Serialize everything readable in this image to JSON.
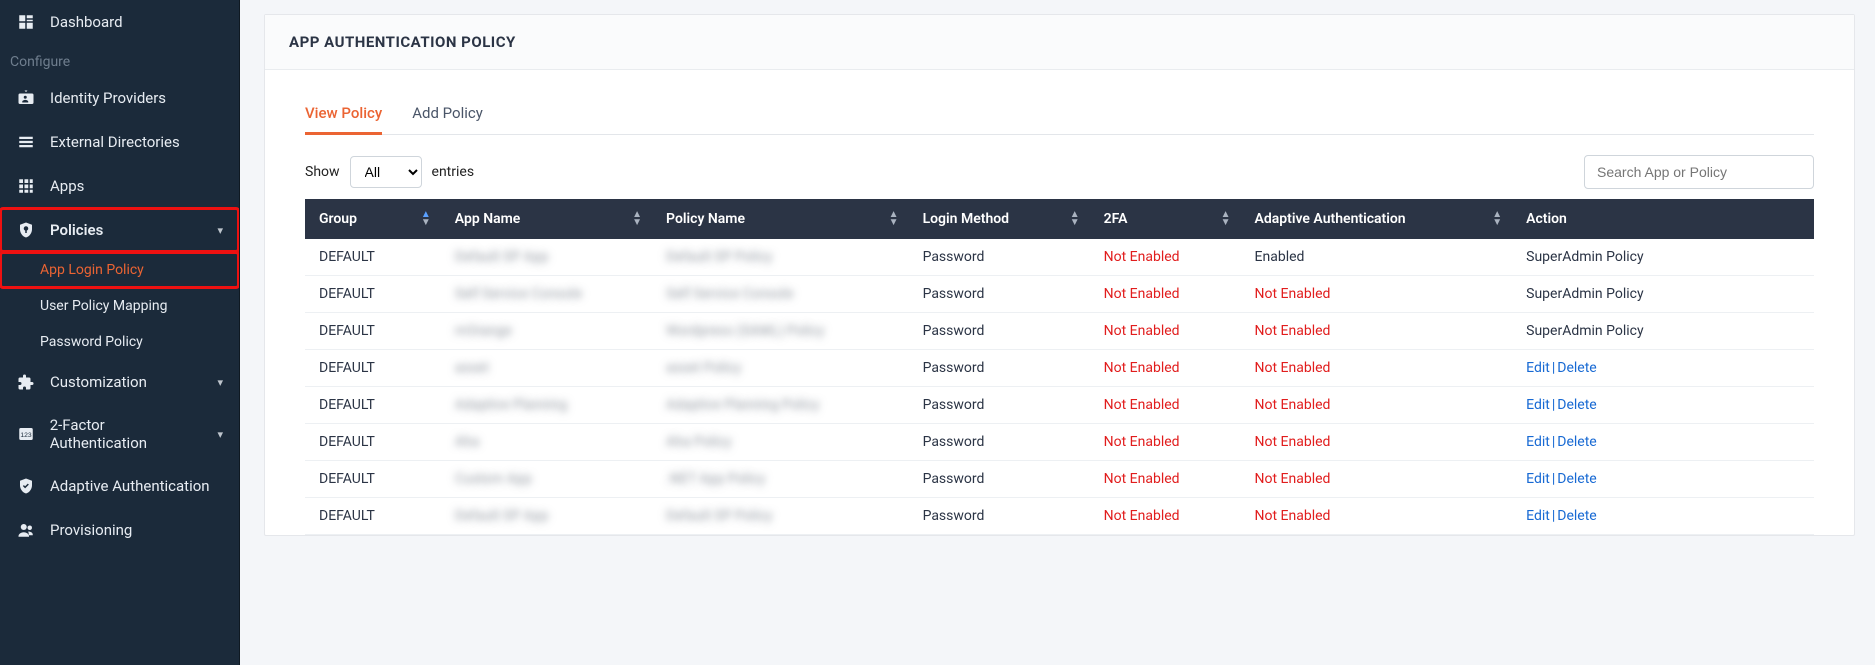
{
  "sidebar": {
    "dashboard": "Dashboard",
    "configure_label": "Configure",
    "identity_providers": "Identity Providers",
    "external_directories": "External Directories",
    "apps": "Apps",
    "policies": "Policies",
    "policies_children": {
      "app_login_policy": "App Login Policy",
      "user_policy_mapping": "User Policy Mapping",
      "password_policy": "Password Policy"
    },
    "customization": "Customization",
    "two_factor": "2-Factor Authentication",
    "adaptive_auth": "Adaptive Authentication",
    "provisioning": "Provisioning"
  },
  "page": {
    "title": "APP AUTHENTICATION POLICY",
    "tabs": {
      "view": "View Policy",
      "add": "Add Policy"
    },
    "show_label_pre": "Show",
    "show_label_post": "entries",
    "show_value": "All",
    "search_placeholder": "Search App or Policy"
  },
  "table": {
    "columns": {
      "group": "Group",
      "app_name": "App Name",
      "policy_name": "Policy Name",
      "login_method": "Login Method",
      "two_fa": "2FA",
      "adaptive": "Adaptive Authentication",
      "action": "Action"
    },
    "text": {
      "enabled": "Enabled",
      "not_enabled": "Not Enabled",
      "edit": "Edit",
      "delete": "Delete",
      "superadmin_policy": "SuperAdmin Policy"
    },
    "rows": [
      {
        "group": "DEFAULT",
        "app": "Default SP App",
        "policy": "Default SP Policy",
        "login": "Password",
        "twofa": "not",
        "adaptive": "enabled",
        "action": "super"
      },
      {
        "group": "DEFAULT",
        "app": "Self Service Console",
        "policy": "Self Service Console",
        "login": "Password",
        "twofa": "not",
        "adaptive": "not",
        "action": "super"
      },
      {
        "group": "DEFAULT",
        "app": "mOrange",
        "policy": "Wordpress (SAML) Policy",
        "login": "Password",
        "twofa": "not",
        "adaptive": "not",
        "action": "super"
      },
      {
        "group": "DEFAULT",
        "app": "asset",
        "policy": "asset Policy",
        "login": "Password",
        "twofa": "not",
        "adaptive": "not",
        "action": "links"
      },
      {
        "group": "DEFAULT",
        "app": "Adaptive Planning",
        "policy": "Adaptive Planning Policy",
        "login": "Password",
        "twofa": "not",
        "adaptive": "not",
        "action": "links"
      },
      {
        "group": "DEFAULT",
        "app": "Aha",
        "policy": "Aha Policy",
        "login": "Password",
        "twofa": "not",
        "adaptive": "not",
        "action": "links"
      },
      {
        "group": "DEFAULT",
        "app": "Custom App",
        "policy": ".NET App Policy",
        "login": "Password",
        "twofa": "not",
        "adaptive": "not",
        "action": "links"
      },
      {
        "group": "DEFAULT",
        "app": "Default SP App",
        "policy": "Default SP Policy",
        "login": "Password",
        "twofa": "not",
        "adaptive": "not",
        "action": "links"
      }
    ]
  }
}
